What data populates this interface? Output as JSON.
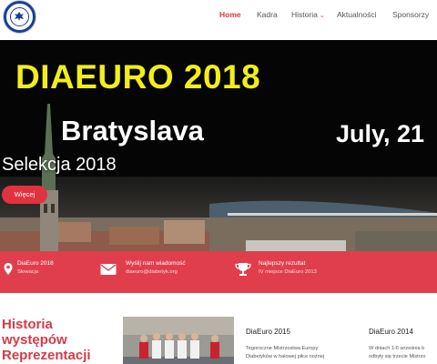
{
  "nav": {
    "items": [
      {
        "label": "Home",
        "active": true
      },
      {
        "label": "Kadra",
        "active": false
      },
      {
        "label": "Historia",
        "active": false,
        "has_dropdown": true
      },
      {
        "label": "Aktualności",
        "active": false
      },
      {
        "label": "Sponsorzy",
        "active": false
      }
    ],
    "dropdown_glyph": "⌄"
  },
  "hero": {
    "title": "DIAEURO 2018",
    "city": "Bratyslava",
    "date": "July, 21",
    "subtitle": "Selekcja 2018",
    "button_label": "Więcej"
  },
  "info_bar": {
    "items": [
      {
        "icon": "map-marker-icon",
        "title": "DiaEuro 2018",
        "subtitle": "Słowacja"
      },
      {
        "icon": "envelope-icon",
        "title": "Wyślij nam wiadomość",
        "subtitle": "diaeuro@diabetyk.org"
      },
      {
        "icon": "trophy-icon",
        "title": "Najlepszy rezultat",
        "subtitle": "IV miejsce DiaEuro 2013"
      }
    ]
  },
  "history": {
    "line1": "Historia",
    "line2": "występów",
    "line3": "Reprezentacji"
  },
  "cards": [
    {
      "title": "DiaEuro 2015",
      "line1": "Tegoroczne Mistrzostwa Europy",
      "line2": "Diabetyków w halowej piłce nożnej"
    },
    {
      "title": "DiaEuro 2014",
      "line1": "W dniach 1-6 września b",
      "line2": "odbyły się trzecie Mistrzo"
    }
  ],
  "colors": {
    "accent": "#e2323f",
    "info_bar": "#e03e4c",
    "hero_title": "#f2ee18",
    "logo": "#1c3f94"
  }
}
